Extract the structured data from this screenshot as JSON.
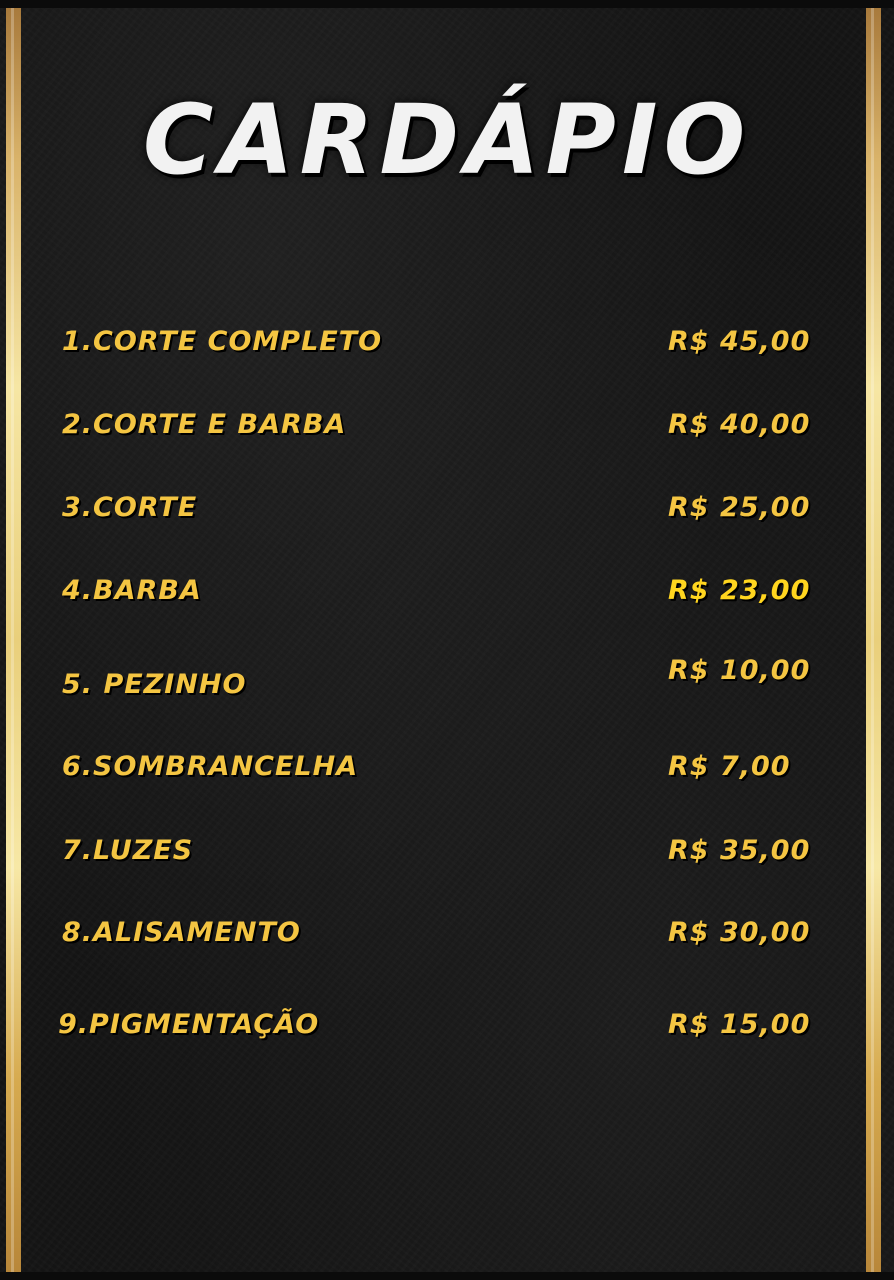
{
  "menu": {
    "title": "CARDÁPIO",
    "accent_color": "#f4c542",
    "border_color": "#e9cf7b",
    "items": [
      {
        "name": "1.CORTE COMPLETO",
        "price": "R$ 45,00"
      },
      {
        "name": "2.CORTE E BARBA",
        "price": "R$ 40,00"
      },
      {
        "name": "3.CORTE",
        "price": "R$ 25,00"
      },
      {
        "name": "4.BARBA",
        "price": "R$ 23,00"
      },
      {
        "name": "5. PEZINHO",
        "price": "R$ 10,00"
      },
      {
        "name": "6.SOMBRANCELHA",
        "price": "R$ 7,00"
      },
      {
        "name": "7.LUZES",
        "price": "R$ 35,00"
      },
      {
        "name": "8.ALISAMENTO",
        "price": "R$ 30,00"
      },
      {
        "name": "9.PIGMENTAÇÃO",
        "price": "R$ 15,00"
      }
    ]
  }
}
